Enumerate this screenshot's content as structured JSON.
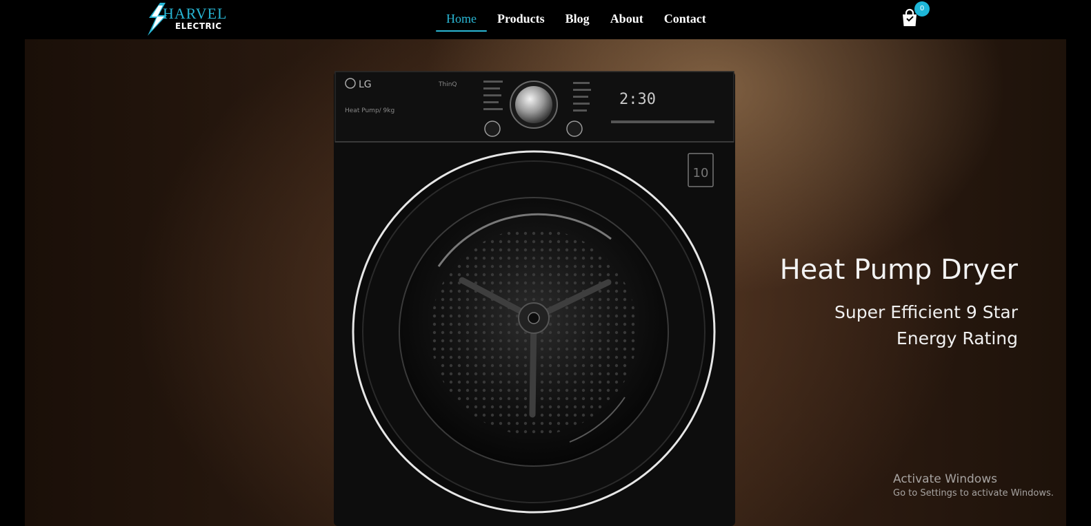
{
  "brand": {
    "name_top": "HARVEL",
    "name_bottom": "ELECTRIC"
  },
  "nav": {
    "items": [
      {
        "label": "Home",
        "active": true
      },
      {
        "label": "Products",
        "active": false
      },
      {
        "label": "Blog",
        "active": false
      },
      {
        "label": "About",
        "active": false
      },
      {
        "label": "Contact",
        "active": false
      }
    ]
  },
  "cart": {
    "count": "0"
  },
  "hero": {
    "title": "Heat Pump Dryer",
    "subtitle": "Super Efficient 9 Star Energy Rating",
    "product": {
      "brand_label": "LG",
      "thinq_label": "ThinQ",
      "model_label": "Heat Pump/ 9kg",
      "display_time": "2:30"
    }
  },
  "watermark": {
    "title": "Activate Windows",
    "subtitle": "Go to Settings to activate Windows."
  },
  "colors": {
    "accent": "#2ab8d6",
    "nav_bg": "#000000",
    "hero_text": "#f2f2f2"
  },
  "icons": {
    "logo": "lightning-bolt-icon",
    "cart": "shopping-bag-icon"
  }
}
